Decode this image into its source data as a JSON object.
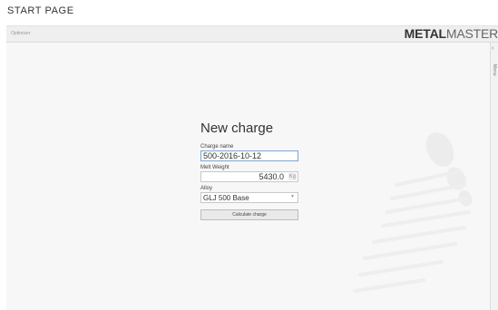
{
  "caption": "START PAGE",
  "topbar": {
    "app_name": "Optimizer",
    "logo_bold": "METAL",
    "logo_light": "MASTER"
  },
  "sidepanel": {
    "chevron": "‹",
    "label": "Menu"
  },
  "form": {
    "title": "New charge",
    "charge_name_label": "Charge name",
    "charge_name_value": "500-2016-10-12",
    "melt_weight_label": "Melt Weight",
    "melt_weight_value": "5430.0",
    "melt_weight_unit": "Kg",
    "alloy_label": "Alloy",
    "alloy_value": "GLJ 500 Base",
    "calculate_label": "Calculate charge"
  },
  "colors": {
    "focus_border": "#7fa4d6",
    "watermark": "#ececec"
  }
}
